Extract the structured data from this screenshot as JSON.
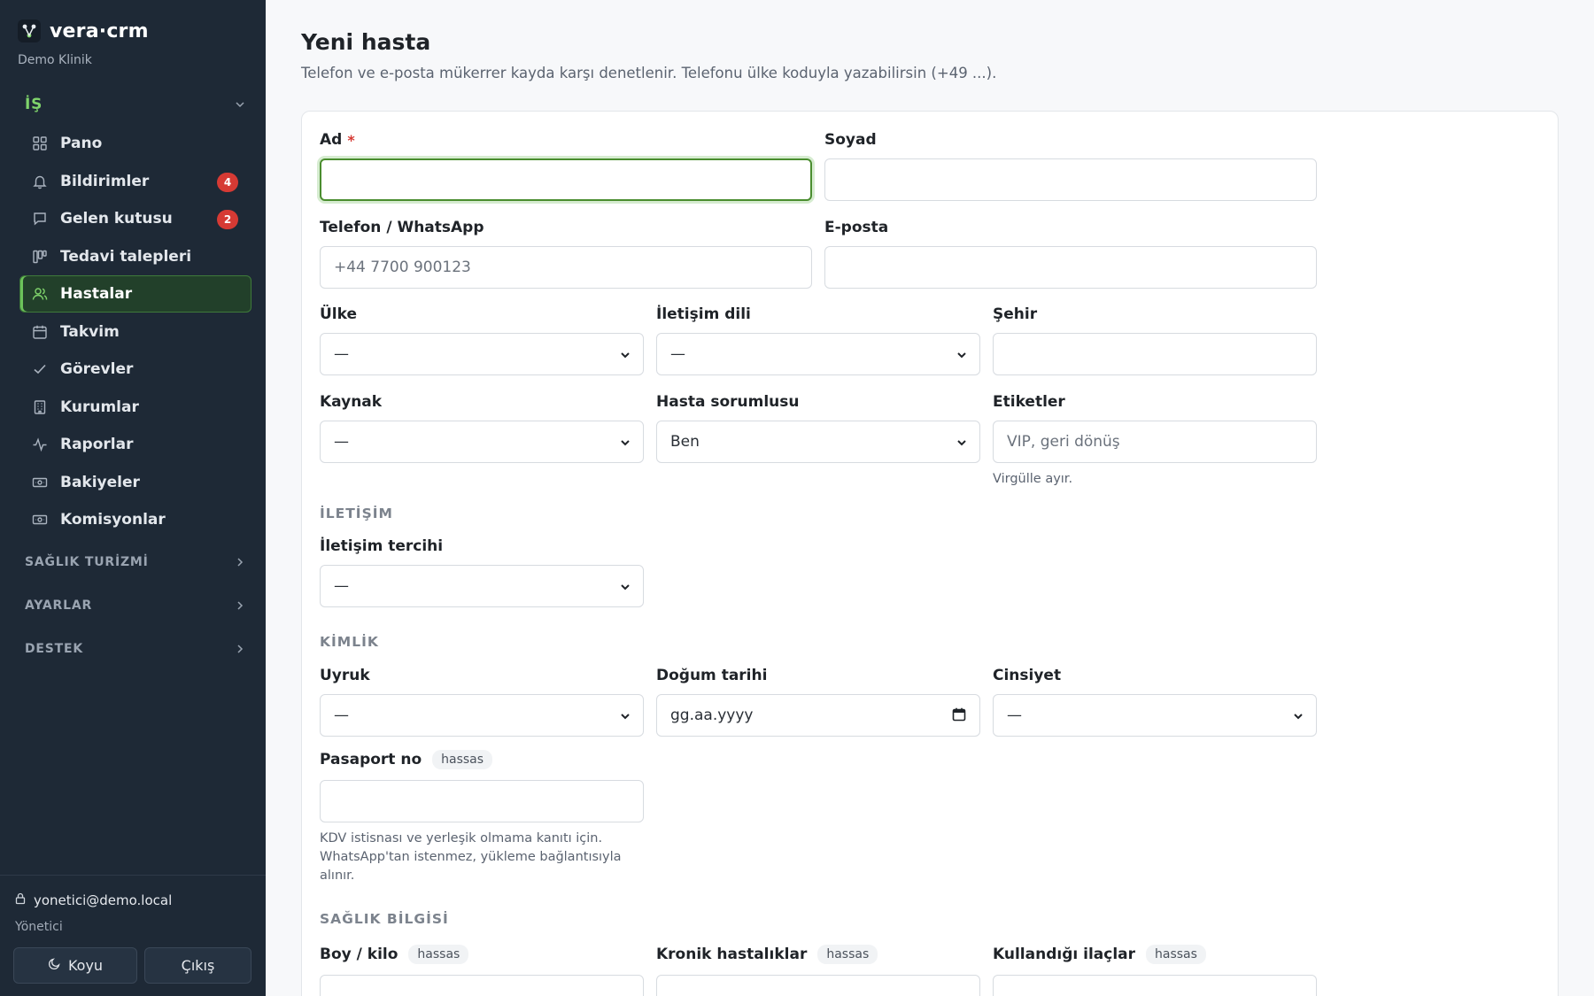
{
  "sidebar": {
    "brand": "vera·crm",
    "clinic": "Demo Klinik",
    "active_group": "İŞ",
    "items": [
      {
        "label": "Pano",
        "icon": "grid-icon"
      },
      {
        "label": "Bildirimler",
        "icon": "bell-icon",
        "badge": "4"
      },
      {
        "label": "Gelen kutusu",
        "icon": "chat-icon",
        "badge": "2"
      },
      {
        "label": "Tedavi talepleri",
        "icon": "kanban-icon"
      },
      {
        "label": "Hastalar",
        "icon": "users-icon",
        "active": true
      },
      {
        "label": "Takvim",
        "icon": "calendar-icon"
      },
      {
        "label": "Görevler",
        "icon": "check-icon"
      },
      {
        "label": "Kurumlar",
        "icon": "building-icon"
      },
      {
        "label": "Raporlar",
        "icon": "activity-icon"
      },
      {
        "label": "Bakiyeler",
        "icon": "banknote-icon"
      },
      {
        "label": "Komisyonlar",
        "icon": "banknote-icon"
      }
    ],
    "groups": [
      "SAĞLIK TURİZMİ",
      "AYARLAR",
      "DESTEK"
    ],
    "user_email": "yonetici@demo.local",
    "user_role": "Yönetici",
    "dark_button": "Koyu",
    "logout_button": "Çıkış"
  },
  "page": {
    "title": "Yeni hasta",
    "subtitle": "Telefon ve e-posta mükerrer kayda karşı denetlenir. Telefonu ülke koduyla yazabilirsin (+49 ...)."
  },
  "form": {
    "first_name": {
      "label": "Ad",
      "required": "*",
      "value": ""
    },
    "last_name": {
      "label": "Soyad",
      "value": ""
    },
    "phone": {
      "label": "Telefon / WhatsApp",
      "placeholder": "+44 7700 900123"
    },
    "email": {
      "label": "E-posta",
      "value": ""
    },
    "country": {
      "label": "Ülke",
      "value": "—"
    },
    "contact_language": {
      "label": "İletişim dili",
      "value": "—"
    },
    "city": {
      "label": "Şehir",
      "value": ""
    },
    "source": {
      "label": "Kaynak",
      "value": "—"
    },
    "owner": {
      "label": "Hasta sorumlusu",
      "value": "Ben"
    },
    "tags": {
      "label": "Etiketler",
      "placeholder": "VIP, geri dönüş",
      "hint": "Virgülle ayır."
    },
    "section_contact": "İLETİŞİM",
    "contact_pref": {
      "label": "İletişim tercihi",
      "value": "—"
    },
    "section_identity": "KİMLİK",
    "nationality": {
      "label": "Uyruk",
      "value": "—"
    },
    "birth_date": {
      "label": "Doğum tarihi",
      "placeholder": "gg.aa.yyyy"
    },
    "gender": {
      "label": "Cinsiyet",
      "value": "—"
    },
    "passport": {
      "label": "Pasaport no",
      "tag": "hassas",
      "hint": "KDV istisnası ve yerleşik olmama kanıtı için. WhatsApp'tan istenmez, yükleme bağlantısıyla alınır."
    },
    "section_health": "SAĞLIK BİLGİSİ",
    "height_weight": {
      "label": "Boy / kilo",
      "tag": "hassas"
    },
    "chronic": {
      "label": "Kronik hastalıklar",
      "tag": "hassas"
    },
    "medications": {
      "label": "Kullandığı ilaçlar",
      "tag": "hassas"
    }
  }
}
